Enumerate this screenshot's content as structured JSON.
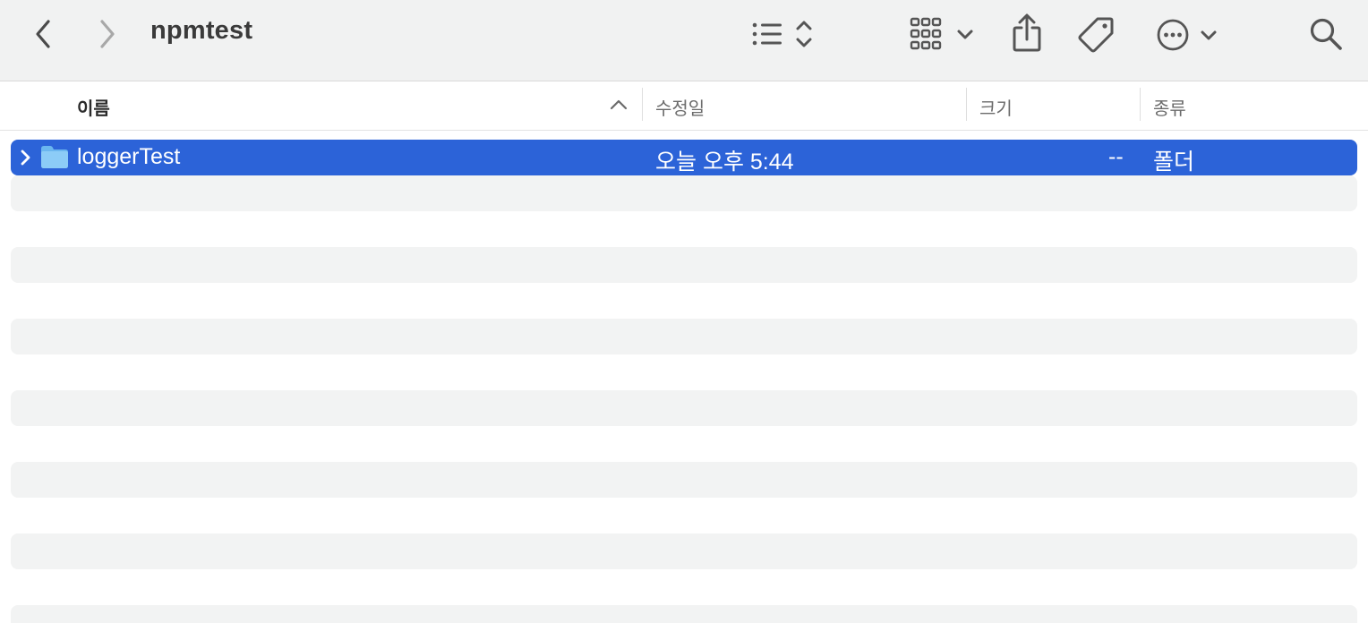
{
  "window": {
    "title": "npmtest"
  },
  "toolbar": {
    "back_icon": "chevron-left-icon",
    "forward_icon": "chevron-right-icon",
    "view_icon": "list-view-icon",
    "group_icon": "grid-group-icon",
    "share_icon": "share-icon",
    "tag_icon": "tag-icon",
    "more_icon": "ellipsis-circle-icon",
    "search_icon": "search-icon"
  },
  "columns": {
    "name": "이름",
    "modified": "수정일",
    "size": "크기",
    "kind": "종류",
    "sort_icon": "chevron-up-icon"
  },
  "files": [
    {
      "name": "loggerTest",
      "modified": "오늘 오후 5:44",
      "size": "--",
      "kind": "폴더",
      "icon": "folder-icon",
      "selected": true
    }
  ],
  "colors": {
    "selection": "#2c63d8",
    "toolbar_bg": "#f1f2f2",
    "stripe": "#f2f3f3"
  }
}
